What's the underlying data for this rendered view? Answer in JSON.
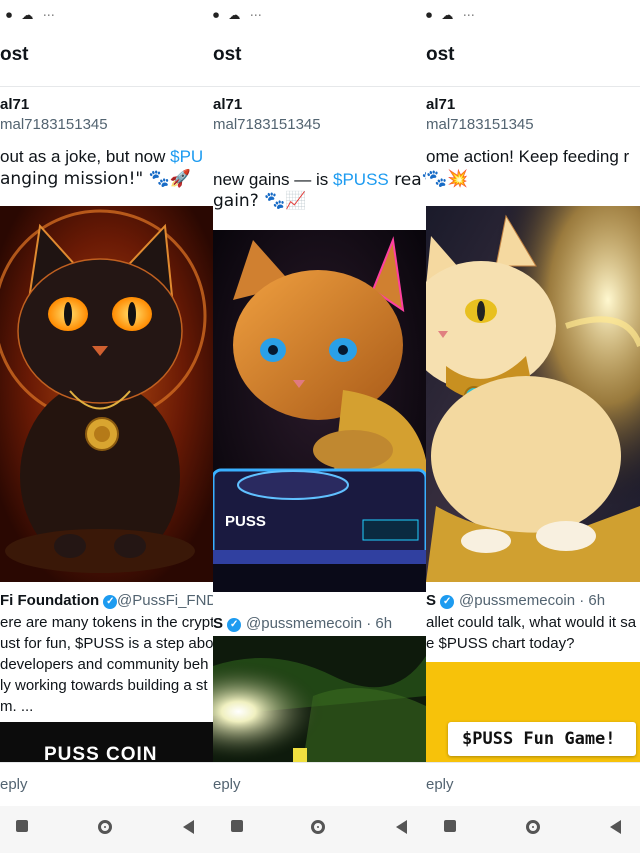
{
  "status": {
    "icons": "⏺ ☁ ⋯"
  },
  "panels": [
    {
      "header": "ost",
      "name": "al71",
      "handle": "mal7183151345",
      "text_line1_a": "out as a joke, but now ",
      "text_line1_link": "$PU",
      "text_line2": "anging mission!\" 🐾🚀",
      "quote_name": "Fi Foundation",
      "quote_handle": "@PussFi_FNDN",
      "quote_lines": [
        "ere are many tokens in the crypt",
        "ust for fun, $PUSS is a step abo",
        "developers and community beh",
        "ly working towards building a st",
        "m. ..."
      ],
      "quote_image_text": "PUSS COIN",
      "reply": "eply"
    },
    {
      "header": "ost",
      "name": "al71",
      "handle": "mal7183151345",
      "text_line1_a": " new gains — is ",
      "text_line1_link": "$PUSS",
      "text_line1_b": " rea🐾💥",
      "text_line2": "gain? 🐾📈",
      "quote_name": "S",
      "quote_handle": "@pussmemecoin · 6h",
      "image_label": "PUSS",
      "reply": "eply"
    },
    {
      "header": "ost",
      "name": "al71",
      "handle": "mal7183151345",
      "text_line1_a": "ome action! Keep feeding r",
      "text_line2": "🐾💥",
      "quote_name": "S",
      "quote_handle": "@pussmemecoin · 6h",
      "quote_lines": [
        "allet could talk, what would it sa",
        "e $PUSS chart today?"
      ],
      "quote_image_text": "$PUSS Fun Game!",
      "reply": "eply"
    }
  ],
  "nav": {
    "back": "back",
    "home": "home",
    "recents": "recents"
  }
}
